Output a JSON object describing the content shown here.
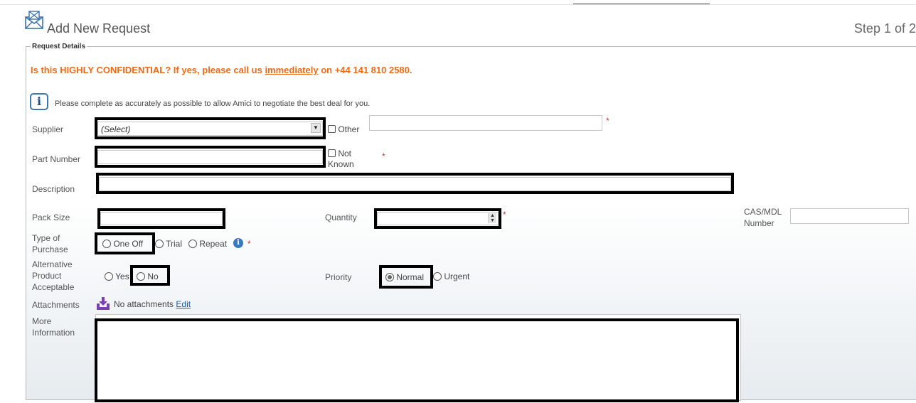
{
  "header": {
    "title": "Add New Request",
    "step": "Step 1 of 2",
    "icon": "envelope-icon"
  },
  "form": {
    "legend": "Request Details",
    "confidential": {
      "pre": "Is this HIGHLY CONFIDENTIAL? If yes, please call us ",
      "link": "immediately",
      "post": " on +44 141 810 2580."
    },
    "intro": "Please complete as accurately as possible to allow Amici to negotiate the best deal for you.",
    "supplier": {
      "label": "Supplier",
      "value": "(Select)",
      "other_label": "Other",
      "other_value": ""
    },
    "part_number": {
      "label": "Part Number",
      "value": "",
      "not_known_line1": "Not",
      "not_known_line2": "Known"
    },
    "description": {
      "label": "Description",
      "value": ""
    },
    "pack_size": {
      "label": "Pack Size",
      "value": ""
    },
    "quantity": {
      "label": "Quantity",
      "value": ""
    },
    "cas": {
      "label_line1": "CAS/MDL",
      "label_line2": "Number",
      "value": ""
    },
    "type_of_purchase": {
      "label_line1": "Type of",
      "label_line2": "Purchase",
      "options": [
        "One Off",
        "Trial",
        "Repeat"
      ]
    },
    "alternative": {
      "label_line1": "Alternative",
      "label_line2": "Product",
      "label_line3": "Acceptable",
      "options": [
        "Yes",
        "No"
      ]
    },
    "priority": {
      "label": "Priority",
      "options": [
        "Normal",
        "Urgent"
      ],
      "selected": "Normal"
    },
    "attachments": {
      "label": "Attachments",
      "text": "No attachments",
      "edit": "Edit"
    },
    "more_info": {
      "label_line1": "More",
      "label_line2": "Information",
      "value": ""
    },
    "required_mark": "*",
    "colors": {
      "accent_orange": "#ef6a17",
      "link_blue": "#1a5aa8",
      "required_red": "#d32f2f",
      "attach_purple": "#7b3fb4"
    }
  }
}
